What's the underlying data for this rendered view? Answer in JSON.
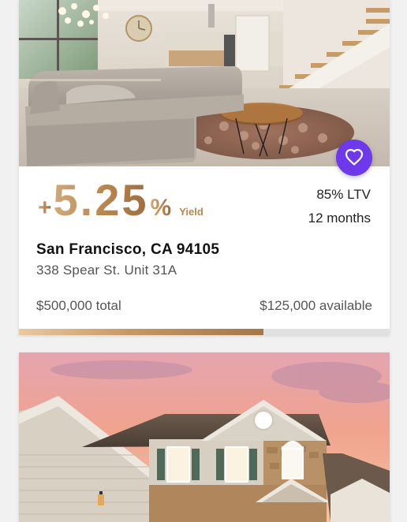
{
  "listings": [
    {
      "yield_sign": "+",
      "yield_value": "5.25",
      "yield_unit": "%",
      "yield_label": "Yield",
      "ltv": "85% LTV",
      "term": "12 months",
      "city_line": "San Francisco, CA 94105",
      "street": "338 Spear St. Unit 31A",
      "total": "$500,000 total",
      "available": "$125,000 available",
      "funded_fraction": 0.66,
      "favorite_icon": "heart-outline-icon",
      "image": "living-room-photo"
    },
    {
      "image": "suburban-house-photo"
    }
  ],
  "colors": {
    "page_bg": "#f1f1f1",
    "accent_gold": "#b8854f",
    "favorite_bg": "#6d39ea",
    "progress_track": "#e1e1e1"
  }
}
